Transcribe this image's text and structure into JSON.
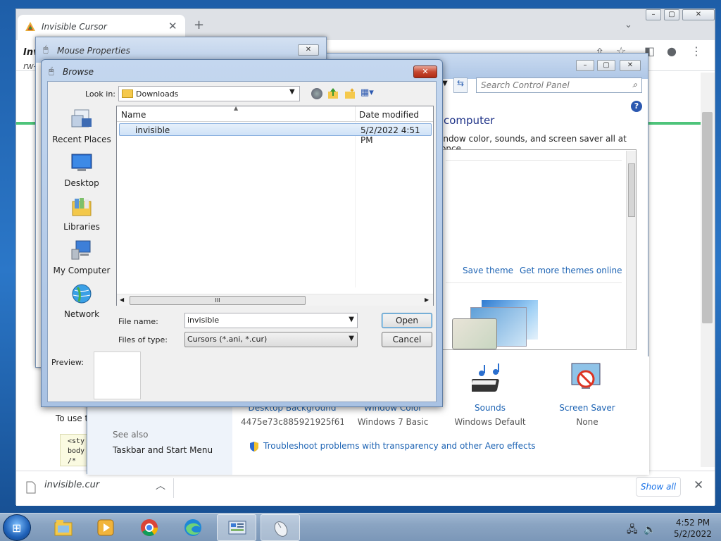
{
  "chrome": {
    "tab_title": "Invisible Cursor",
    "tab_close": "✕",
    "new_tab": "+",
    "page_title_fragment": "Inv",
    "page_sub_fragment": "rw-",
    "touse_fragment": "To use t",
    "code_lines": [
      "<sty",
      "body",
      "  /*"
    ]
  },
  "downloads": {
    "file_name": "invisible.cur",
    "show_all": "Show all",
    "close": "✕"
  },
  "control_panel": {
    "search_placeholder": "Search Control Panel",
    "heading": "computer",
    "description": "indow color, sounds, and screen saver all at once.",
    "help": "?",
    "save_theme": "Save theme",
    "get_more_themes": "Get more themes online",
    "desktop_background_label": "Desktop Background",
    "desktop_background_value": "4475e73c885921925f61fc...",
    "window_color_label": "Window Color",
    "window_color_value": "Windows 7 Basic",
    "sounds_label": "Sounds",
    "sounds_value": "Windows Default",
    "screensaver_label": "Screen Saver",
    "screensaver_value": "None",
    "see_also": "See also",
    "taskbar_link": "Taskbar and Start Menu",
    "troubleshoot": "Troubleshoot problems with transparency and other Aero effects"
  },
  "mouse_properties": {
    "title": "Mouse Properties"
  },
  "browse": {
    "title": "Browse",
    "look_in_label": "Look in:",
    "look_in_value": "Downloads",
    "places": [
      {
        "label": "Recent Places",
        "icon": "recent-places-icon"
      },
      {
        "label": "Desktop",
        "icon": "desktop-icon"
      },
      {
        "label": "Libraries",
        "icon": "libraries-icon"
      },
      {
        "label": "My Computer",
        "icon": "computer-icon"
      },
      {
        "label": "Network",
        "icon": "network-icon"
      }
    ],
    "columns": {
      "name": "Name",
      "date": "Date modified"
    },
    "files": [
      {
        "name": "invisible",
        "date": "5/2/2022 4:51 PM"
      }
    ],
    "hscroll_grip": "III",
    "file_name_label": "File name:",
    "file_name_value": "invisible",
    "file_type_label": "Files of type:",
    "file_type_value": "Cursors (*.ani, *.cur)",
    "open_label": "Open",
    "cancel_label": "Cancel",
    "preview_label": "Preview:"
  },
  "taskbar": {
    "time": "4:52 PM",
    "date": "5/2/2022"
  },
  "colors": {
    "accent": "#1e64b4",
    "highlight": "#cfe2f7",
    "green_bar": "#4ec47a"
  }
}
